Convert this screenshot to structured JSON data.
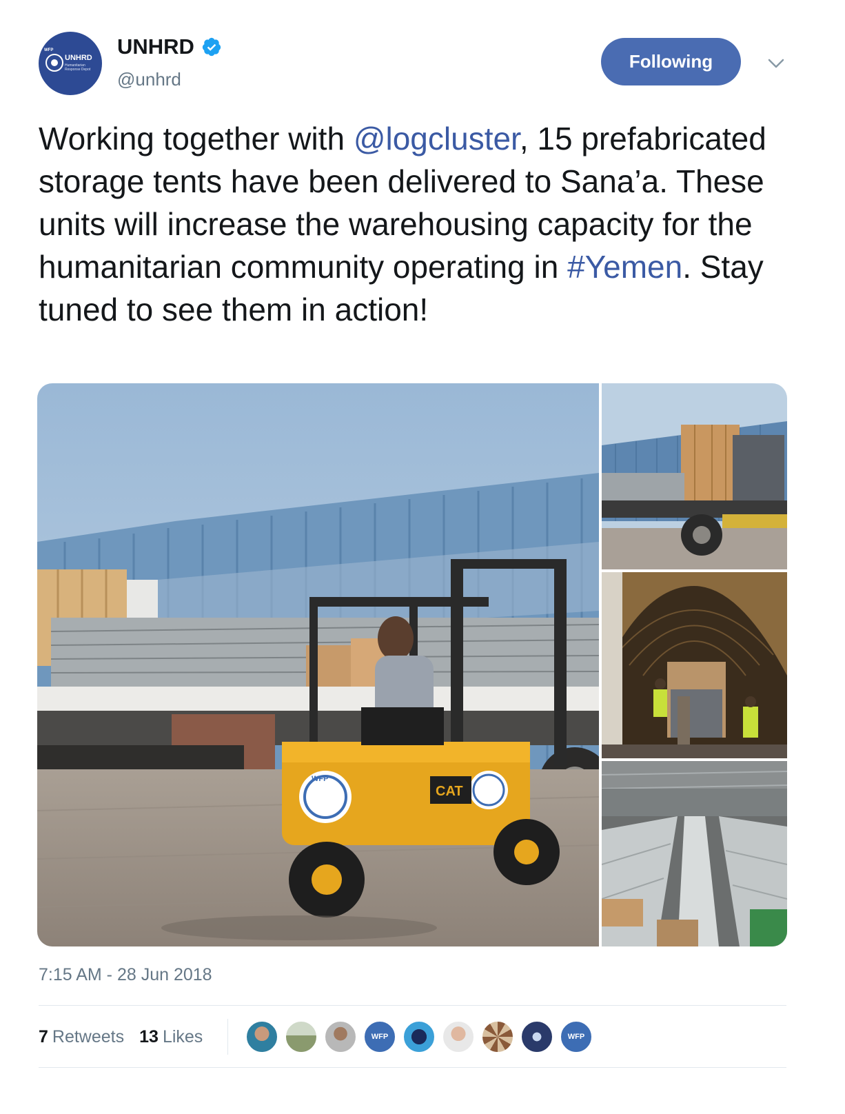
{
  "user": {
    "display_name": "UNHRD",
    "handle": "@unhrd",
    "verified": true,
    "avatar_text": {
      "wfp": "WFP",
      "name": "UNHRD",
      "sub": "Humanitarian Response Depot"
    }
  },
  "follow_button": {
    "label": "Following"
  },
  "tweet": {
    "text_parts": {
      "p1": "Working together with ",
      "mention": "@logcluster",
      "p2": ", 15 prefabricated storage tents have been delivered to Sana’a. These units will increase the warehousing capacity for the humanitarian community operating in ",
      "hashtag": "#Yemen",
      "p3": ". Stay tuned to see them in action!"
    },
    "timestamp": "7:15 AM - 28 Jun 2018"
  },
  "photo_texts": {
    "forklift_brand": "CAT",
    "forklift_logo": "WFP"
  },
  "stats": {
    "retweets_count": "7",
    "retweets_label": "Retweets",
    "likes_count": "13",
    "likes_label": "Likes"
  },
  "likers": {
    "wfp_label": "WFP"
  },
  "colors": {
    "accent": "#4a6cb2",
    "link": "#3b5aa4",
    "verified": "#1da1f2",
    "muted": "#657786"
  }
}
